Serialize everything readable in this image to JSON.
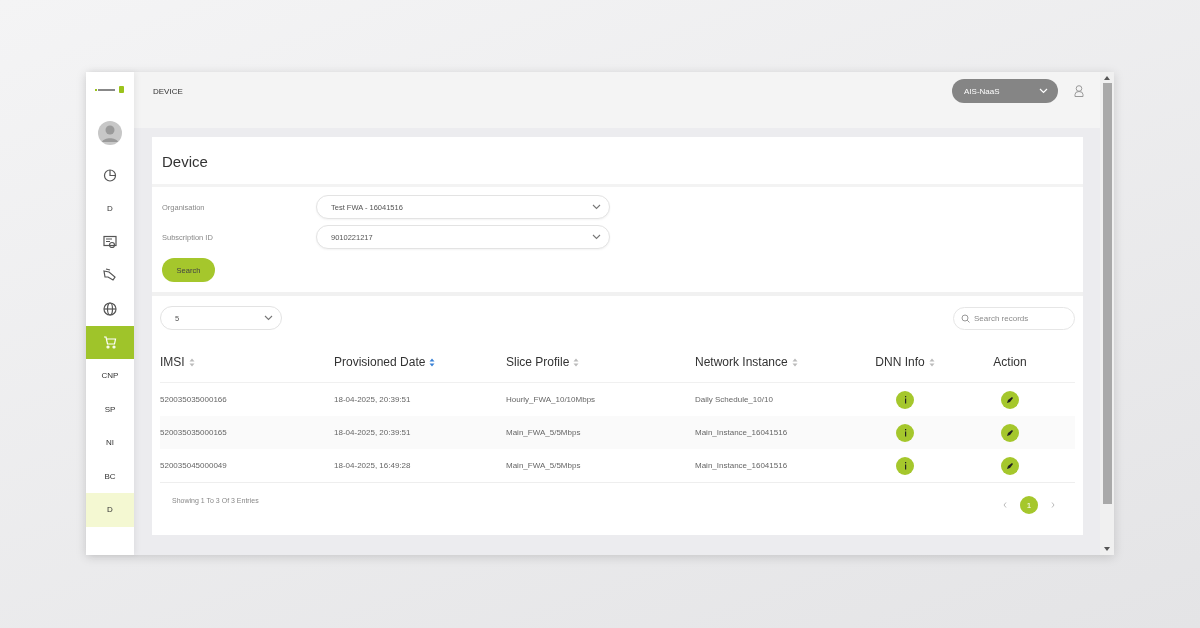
{
  "sidebar": {
    "items": [
      {
        "kind": "icon",
        "selected": false,
        "highlighted": false
      },
      {
        "kind": "text",
        "label": "D",
        "selected": false,
        "highlighted": false
      },
      {
        "kind": "icon",
        "selected": false,
        "highlighted": false
      },
      {
        "kind": "icon",
        "selected": false,
        "highlighted": false
      },
      {
        "kind": "icon",
        "selected": false,
        "highlighted": false
      },
      {
        "kind": "icon",
        "selected": true,
        "highlighted": false
      },
      {
        "kind": "text",
        "label": "CNP",
        "selected": false,
        "highlighted": false
      },
      {
        "kind": "text",
        "label": "SP",
        "selected": false,
        "highlighted": false
      },
      {
        "kind": "text",
        "label": "NI",
        "selected": false,
        "highlighted": false
      },
      {
        "kind": "text",
        "label": "BC",
        "selected": false,
        "highlighted": false
      },
      {
        "kind": "text",
        "label": "D",
        "selected": false,
        "highlighted": true
      }
    ]
  },
  "header": {
    "breadcrumb": "DEVICE",
    "tenant_select": {
      "value": "AIS-NaaS"
    }
  },
  "page": {
    "title": "Device",
    "filters": [
      {
        "label": "Organisation",
        "value": "Test FWA - 16041516"
      },
      {
        "label": "Subscription ID",
        "value": "9010221217"
      }
    ],
    "search_button": "Search"
  },
  "table": {
    "page_size": "5",
    "search": {
      "placeholder": "Search records"
    },
    "columns": [
      {
        "label": "IMSI",
        "sortable": true,
        "sorted": false
      },
      {
        "label": "Provisioned Date",
        "sortable": true,
        "sorted": true
      },
      {
        "label": "Slice Profile",
        "sortable": true,
        "sorted": false
      },
      {
        "label": "Network Instance",
        "sortable": true,
        "sorted": false
      },
      {
        "label": "DNN Info",
        "sortable": true,
        "sorted": false
      },
      {
        "label": "Action",
        "sortable": false
      }
    ],
    "rows": [
      [
        "520035035000166",
        "18-04-2025, 20:39:51",
        "Hourly_FWA_10/10Mbps",
        "Daily Schedule_10/10"
      ],
      [
        "520035035000165",
        "18-04-2025, 20:39:51",
        "Main_FWA_5/5Mbps",
        "Main_Instance_16041516"
      ],
      [
        "520035045000049",
        "18-04-2025, 16:49:28",
        "Main_FWA_5/5Mbps",
        "Main_Instance_16041516"
      ]
    ],
    "footer": "Showing 1 To 3 Of 3 Entries",
    "pages": [
      {
        "label": "1",
        "selected": true
      }
    ]
  }
}
